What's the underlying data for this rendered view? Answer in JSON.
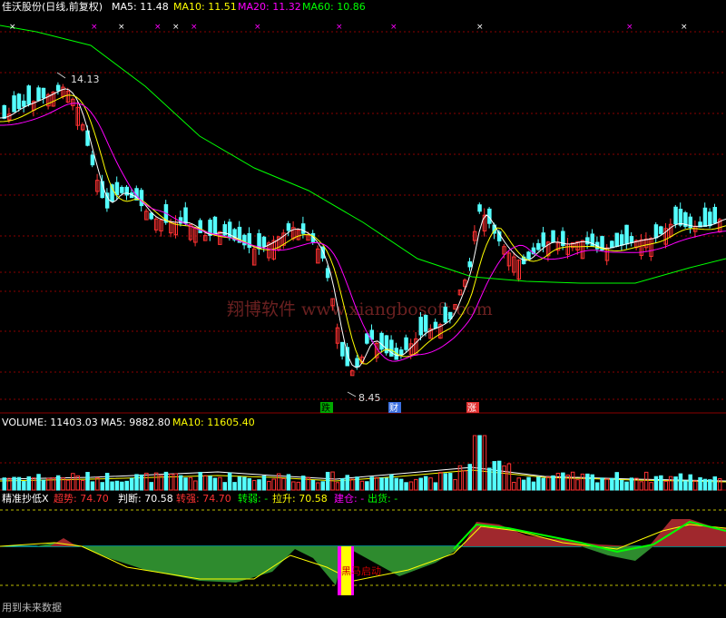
{
  "price_header": {
    "name": "佳沃股份(日线,前复权)",
    "ma5": "MA5: 11.48",
    "ma10": "MA10: 11.51",
    "ma20": "MA20: 11.32",
    "ma60": "MA60: 10.86"
  },
  "volume_header": {
    "vol": "VOLUME: 11403.03",
    "ma5": "MA5: 9882.80",
    "ma10": "MA10: 11605.40"
  },
  "indicator_header": {
    "name": "精准抄低X",
    "trend": "超势: 74.70",
    "judge": "判断: 70.58",
    "strong": "转强: 74.70",
    "weak": "转弱: -",
    "pull": "拉升: 70.58",
    "build": "建仓: -",
    "sell": "出货: -"
  },
  "annotations": {
    "high": "14.13",
    "low": "8.45",
    "die": "跌",
    "cai": "财",
    "zhang": "涨",
    "black_horse": "黑马启动",
    "future": "用到未来数据",
    "watermark": "翔博软件 www.xiangbosoft.com"
  },
  "colors": {
    "up": "#ff3232",
    "down": "#54ffff",
    "ma5": "#ffffff",
    "ma10": "#ffff00",
    "ma20": "#ff00ff",
    "ma60": "#00ff00",
    "grid": "#8b0000"
  },
  "chart_data": {
    "type": "candlestick",
    "high_label": 14.13,
    "low_label": 8.45,
    "ma_series": [
      {
        "name": "MA5",
        "value": 11.48
      },
      {
        "name": "MA10",
        "value": 11.51
      },
      {
        "name": "MA20",
        "value": 11.32
      },
      {
        "name": "MA60",
        "value": 10.86
      }
    ],
    "volume": {
      "value": 11403.03,
      "ma5": 9882.8,
      "ma10": 11605.4
    },
    "indicator": {
      "trend": 74.7,
      "judge": 70.58,
      "strong": 74.7,
      "pull": 70.58
    }
  }
}
